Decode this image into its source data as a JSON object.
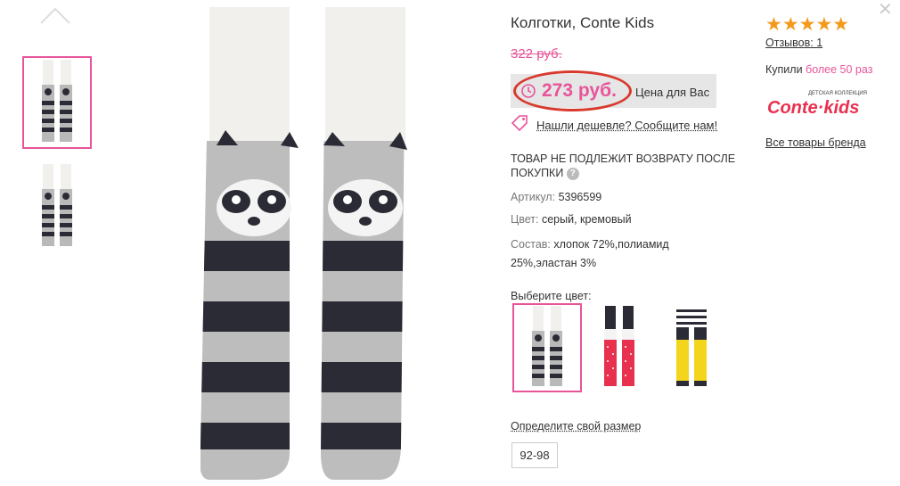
{
  "product": {
    "title": "Колготки, Conte Kids",
    "old_price": "322 руб.",
    "price": "273 руб.",
    "price_label": "Цена для Вас",
    "cheaper_link": "Нашли дешевле? Сообщите нам!",
    "no_return": "ТОВАР НЕ ПОДЛЕЖИТ ВОЗВРАТУ ПОСЛЕ ПОКУПКИ",
    "article_label": "Артикул:",
    "article_value": "5396599",
    "color_label": "Цвет:",
    "color_value": "серый, кремовый",
    "composition_label": "Состав:",
    "composition_value": "хлопок 72%,полиамид 25%,эластан 3%"
  },
  "color_picker": {
    "label": "Выберите цвет:",
    "swatches": [
      {
        "name": "raccoon-grey",
        "selected": true,
        "leg": "#b9b9b9",
        "stripe": "#2b2b35",
        "top": "#f2f0ec"
      },
      {
        "name": "red-polka",
        "selected": false,
        "leg": "#e8314f",
        "stripe": "#e8314f",
        "top": "#2b2b35"
      },
      {
        "name": "yellow-cat",
        "selected": false,
        "leg": "#f2d51c",
        "stripe": "#2b2b35",
        "top": "#2b2b35"
      }
    ]
  },
  "size": {
    "label": "Определите свой размер",
    "options": [
      "92-98"
    ]
  },
  "sidebar": {
    "stars": "★★★★★",
    "rating": 5,
    "reviews": "Отзывов: 1",
    "bought_prefix": "Купили",
    "bought_highlight": "более 50 раз",
    "brand_logo_small": "ДЕТСКАЯ КОЛЛЕКЦИЯ",
    "brand_logo_text": "Conte·kids",
    "brand_link": "Все товары бренда"
  },
  "colors": {
    "accent": "#e8549a",
    "star": "#f39a1c",
    "oval": "#d83a2e",
    "price_bg": "#e6e6e6"
  },
  "icons": [
    "chevron-up-icon",
    "clock-icon",
    "price-tag-icon",
    "question-icon",
    "close-icon"
  ]
}
